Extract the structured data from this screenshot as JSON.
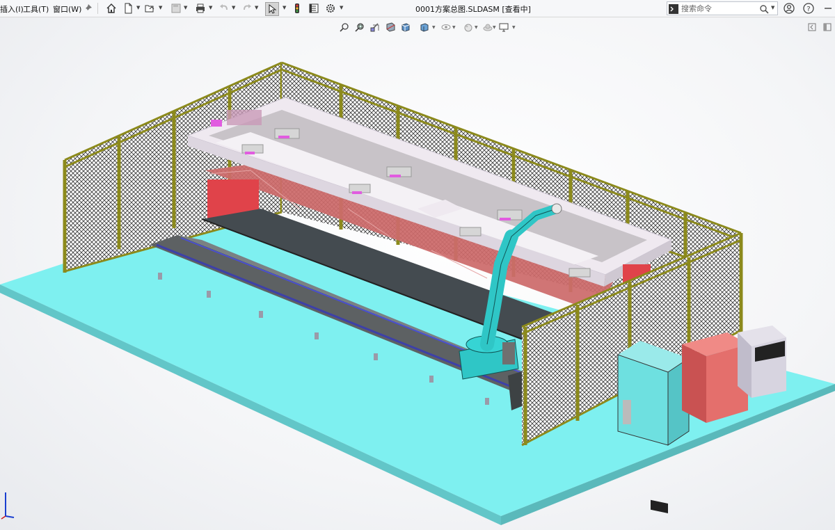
{
  "menu": {
    "insert": "插入(I)",
    "tools": "工具(T)",
    "window": "窗口(W)"
  },
  "window_title": "0001方案总图.SLDASM [查看中]",
  "search": {
    "placeholder": "搜索命令"
  },
  "icons": {
    "toolbar": [
      "pin-icon",
      "home-icon",
      "new-document-icon",
      "open-file-icon",
      "save-icon",
      "print-icon",
      "undo-icon",
      "redo-icon",
      "select-pointer-icon",
      "traffic-light-icon",
      "file-properties-icon",
      "options-gear-icon"
    ],
    "right": [
      "command-prompt-icon",
      "search-icon",
      "user-account-icon",
      "help-icon",
      "minimize-icon"
    ],
    "heads_up": [
      "zoom-to-fit-icon",
      "zoom-to-area-icon",
      "previous-view-icon",
      "section-view-icon",
      "view-orientation-icon",
      "display-style-icon",
      "hide-show-items-icon",
      "edit-appearance-icon",
      "apply-scene-icon",
      "view-settings-icon",
      "display-pane-toggle-icon",
      "expand-icon"
    ]
  },
  "colors": {
    "floor": "#7ef0f0",
    "fence_frame": "#8c8a1c",
    "robot": "#2fc6c6",
    "gantry_beam": "#efe9f0",
    "gantry_side": "#cc6b6b",
    "red_parts": "#e0434a",
    "rail_dark": "#444b50",
    "control_cabinet": "#6ee0e0",
    "welder_cabinet": "#e46f6c",
    "grey_cabinet": "#d7d4e0"
  }
}
